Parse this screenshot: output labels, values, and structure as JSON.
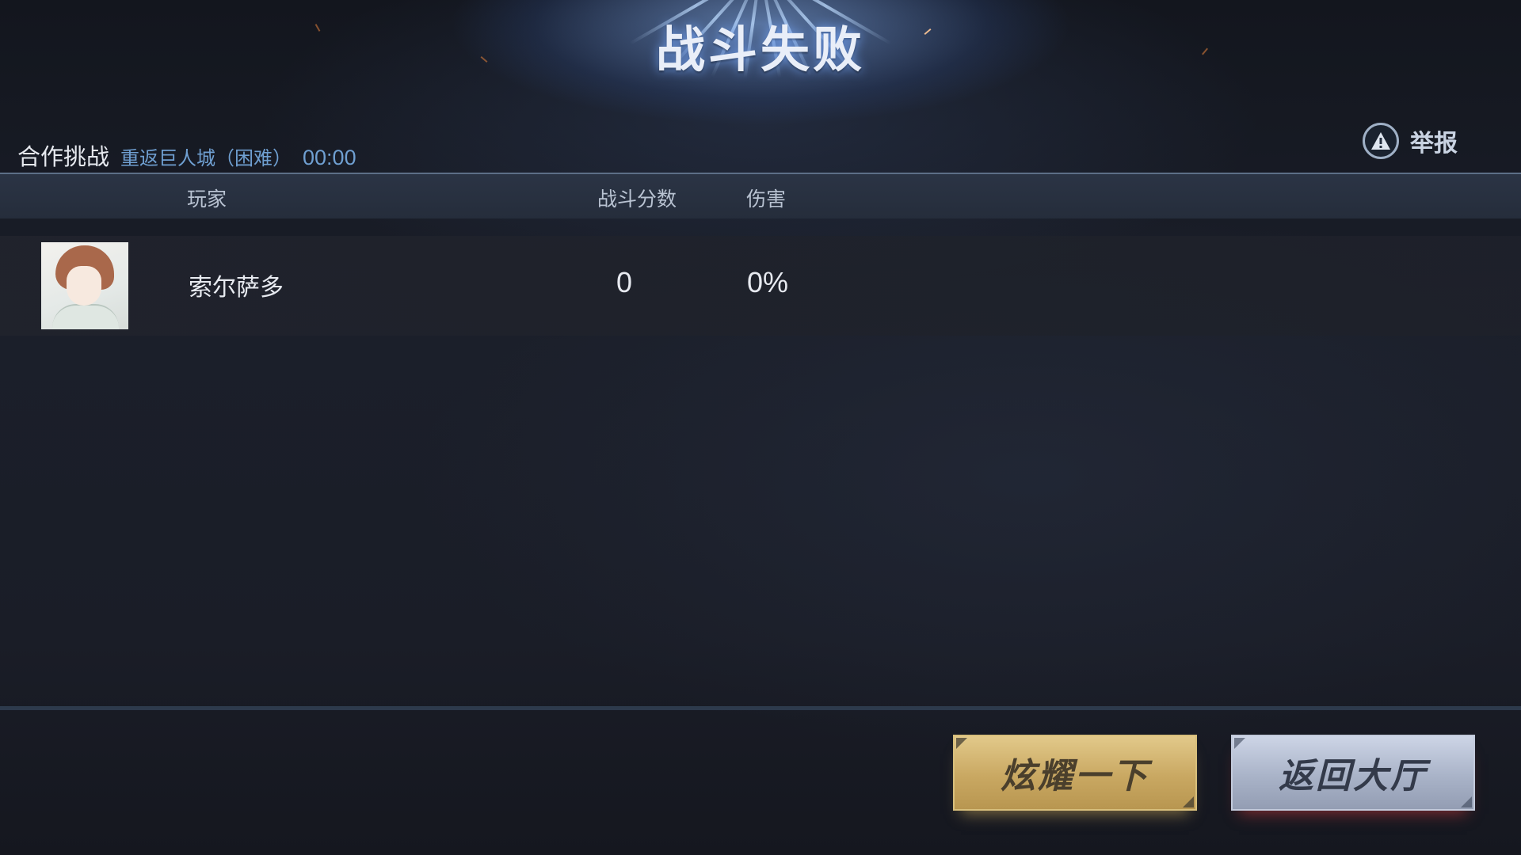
{
  "result_title": "战斗失败",
  "mode": {
    "label": "合作挑战",
    "stage": "重返巨人城（困难）",
    "timer": "00:00"
  },
  "report": {
    "label": "举报",
    "icon": "warning-triangle-icon"
  },
  "table": {
    "headers": {
      "player": "玩家",
      "score": "战斗分数",
      "damage": "伤害"
    },
    "rows": [
      {
        "name": "索尔萨多",
        "score": "0",
        "damage": "0%",
        "avatar": "anime-boy-avatar"
      }
    ]
  },
  "buttons": {
    "show_off": "炫耀一下",
    "return_lobby": "返回大厅"
  },
  "colors": {
    "accent_blue": "#6f9fd1",
    "gold_button": "#c9a862",
    "silver_button": "#a9b3c8"
  }
}
